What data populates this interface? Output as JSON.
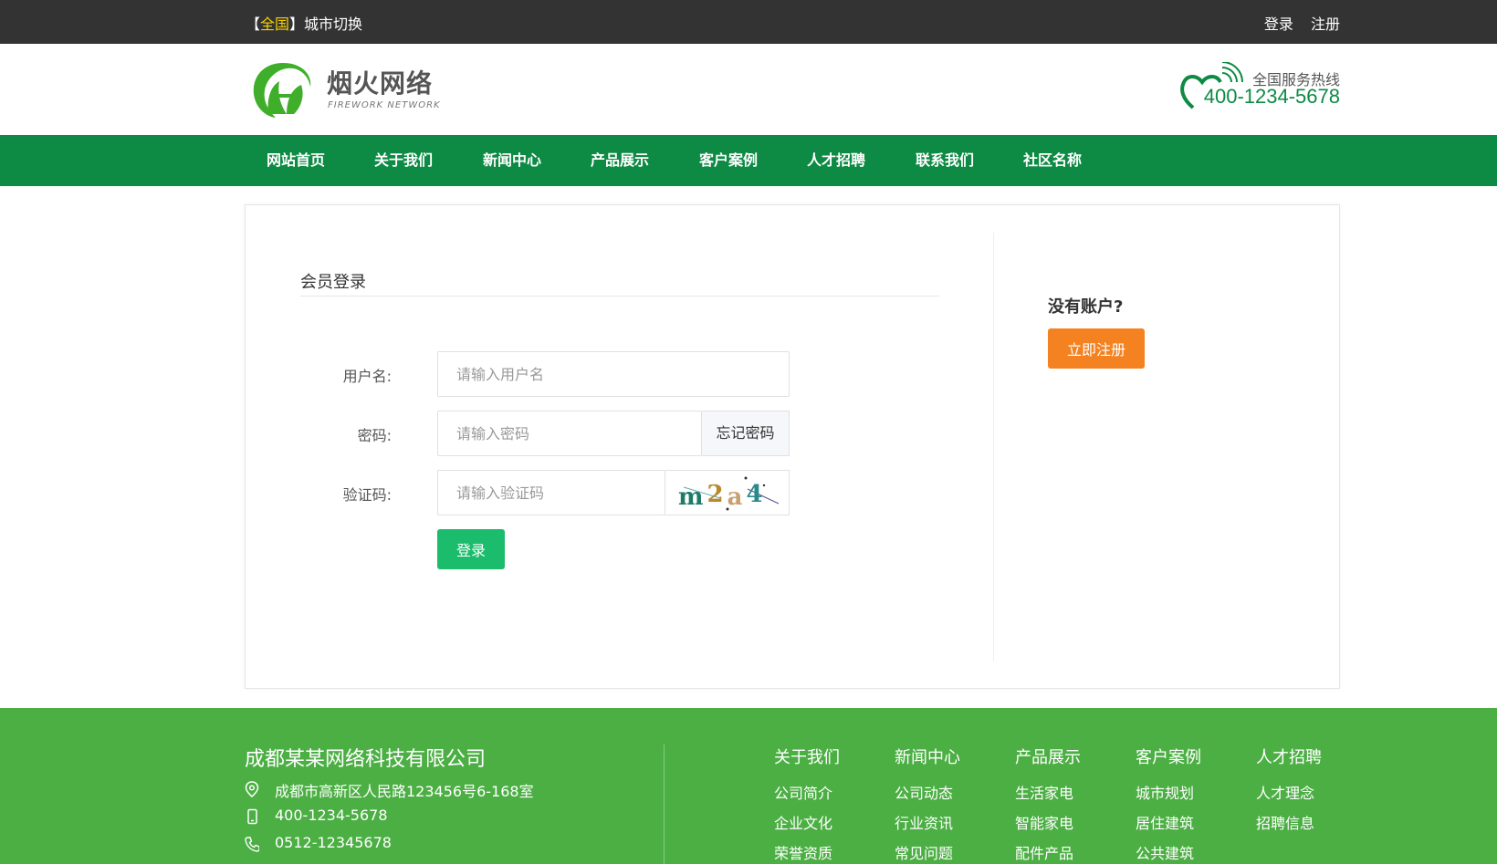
{
  "topbar": {
    "city_bracket_open": "【",
    "city_highlight": "全国",
    "city_bracket_close": "】",
    "city_switch": "城市切换",
    "login": "登录",
    "register": "注册"
  },
  "header": {
    "brand_name": "烟火网络",
    "brand_en": "FIREWORK NETWORK",
    "hotline_label": "全国服务热线",
    "hotline_number": "400-1234-5678"
  },
  "nav": {
    "items": [
      "网站首页",
      "关于我们",
      "新闻中心",
      "产品展示",
      "客户案例",
      "人才招聘",
      "联系我们",
      "社区名称"
    ]
  },
  "login_form": {
    "title": "会员登录",
    "username_label": "用户名:",
    "username_placeholder": "请输入用户名",
    "password_label": "密码:",
    "password_placeholder": "请输入密码",
    "forgot_password": "忘记密码",
    "captcha_label": "验证码:",
    "captcha_placeholder": "请输入验证码",
    "captcha_text": "m2a4",
    "submit": "登录"
  },
  "side": {
    "no_account": "没有账户?",
    "register_now": "立即注册"
  },
  "footer": {
    "company": "成都某某网络科技有限公司",
    "address": "成都市高新区人民路123456号6-168室",
    "mobile": "400-1234-5678",
    "phone": "0512-12345678",
    "columns": [
      {
        "title": "关于我们",
        "links": [
          "公司简介",
          "企业文化",
          "荣誉资质"
        ]
      },
      {
        "title": "新闻中心",
        "links": [
          "公司动态",
          "行业资讯",
          "常见问题"
        ]
      },
      {
        "title": "产品展示",
        "links": [
          "生活家电",
          "智能家电",
          "配件产品"
        ]
      },
      {
        "title": "客户案例",
        "links": [
          "城市规划",
          "居住建筑",
          "公共建筑"
        ]
      },
      {
        "title": "人才招聘",
        "links": [
          "人才理念",
          "招聘信息"
        ]
      }
    ]
  },
  "colors": {
    "topbar_bg": "#333333",
    "nav_bg": "#0d8a43",
    "login_button": "#1bbc6b",
    "register_button": "#f58220",
    "footer_bg": "#4caf44",
    "highlight_yellow": "#f5d000"
  }
}
